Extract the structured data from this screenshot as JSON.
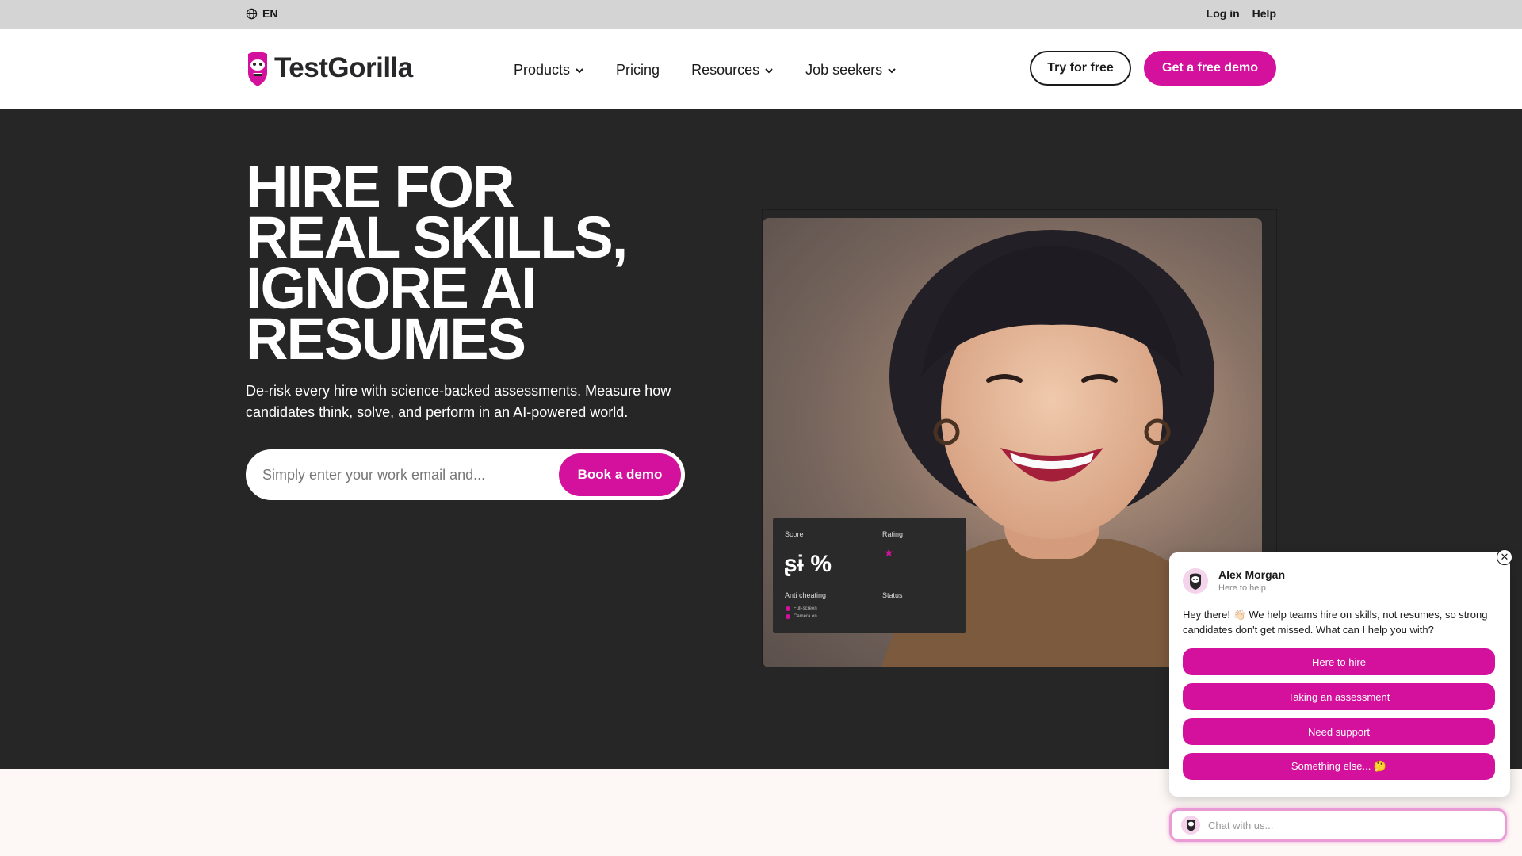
{
  "topbar": {
    "language": "EN",
    "login": "Log in",
    "help": "Help"
  },
  "header": {
    "brand": "TestGorilla",
    "nav": [
      {
        "label": "Products",
        "has_dropdown": true
      },
      {
        "label": "Pricing",
        "has_dropdown": false
      },
      {
        "label": "Resources",
        "has_dropdown": true
      },
      {
        "label": "Job seekers",
        "has_dropdown": true
      }
    ],
    "try_free": "Try for free",
    "get_demo": "Get a free demo"
  },
  "hero": {
    "title_lines": [
      "HIRE FOR",
      "REAL SKILLS,",
      "IGNORE AI",
      "RESUMES"
    ],
    "subtitle": "De-risk every hire with science-backed assessments. Measure how candidates think, solve, and perform in an AI-powered world.",
    "email_placeholder": "Simply enter your work email and...",
    "cta": "Book a demo"
  },
  "score_card": {
    "score_label": "Score",
    "score_value": "ʂɨ %",
    "rating_label": "Rating",
    "anti_cheating_label": "Anti cheating",
    "status_label": "Status",
    "items": [
      "Full-screen",
      "Camera on"
    ]
  },
  "chat": {
    "agent_name": "Alex Morgan",
    "agent_status": "Here to help",
    "message": "Hey there! 👋🏻 We help teams hire on skills, not resumes, so strong candidates don't get missed. What can I help you with?",
    "options": [
      "Here to hire",
      "Taking an assessment",
      "Need support",
      "Something else... 🤔"
    ],
    "input_placeholder": "Chat with us..."
  },
  "colors": {
    "brand_pink": "#d4119d",
    "hero_bg": "#262626",
    "topbar_bg": "#d4d4d4"
  }
}
